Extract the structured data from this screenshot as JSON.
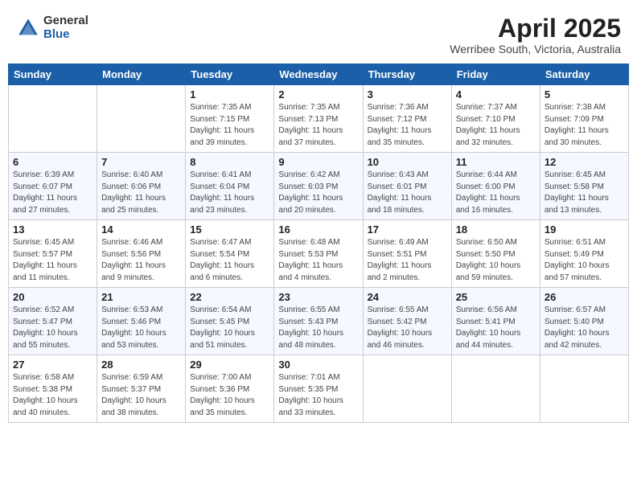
{
  "header": {
    "logo_general": "General",
    "logo_blue": "Blue",
    "month_title": "April 2025",
    "subtitle": "Werribee South, Victoria, Australia"
  },
  "days_of_week": [
    "Sunday",
    "Monday",
    "Tuesday",
    "Wednesday",
    "Thursday",
    "Friday",
    "Saturday"
  ],
  "weeks": [
    [
      {
        "day": "",
        "detail": ""
      },
      {
        "day": "",
        "detail": ""
      },
      {
        "day": "1",
        "detail": "Sunrise: 7:35 AM\nSunset: 7:15 PM\nDaylight: 11 hours and 39 minutes."
      },
      {
        "day": "2",
        "detail": "Sunrise: 7:35 AM\nSunset: 7:13 PM\nDaylight: 11 hours and 37 minutes."
      },
      {
        "day": "3",
        "detail": "Sunrise: 7:36 AM\nSunset: 7:12 PM\nDaylight: 11 hours and 35 minutes."
      },
      {
        "day": "4",
        "detail": "Sunrise: 7:37 AM\nSunset: 7:10 PM\nDaylight: 11 hours and 32 minutes."
      },
      {
        "day": "5",
        "detail": "Sunrise: 7:38 AM\nSunset: 7:09 PM\nDaylight: 11 hours and 30 minutes."
      }
    ],
    [
      {
        "day": "6",
        "detail": "Sunrise: 6:39 AM\nSunset: 6:07 PM\nDaylight: 11 hours and 27 minutes."
      },
      {
        "day": "7",
        "detail": "Sunrise: 6:40 AM\nSunset: 6:06 PM\nDaylight: 11 hours and 25 minutes."
      },
      {
        "day": "8",
        "detail": "Sunrise: 6:41 AM\nSunset: 6:04 PM\nDaylight: 11 hours and 23 minutes."
      },
      {
        "day": "9",
        "detail": "Sunrise: 6:42 AM\nSunset: 6:03 PM\nDaylight: 11 hours and 20 minutes."
      },
      {
        "day": "10",
        "detail": "Sunrise: 6:43 AM\nSunset: 6:01 PM\nDaylight: 11 hours and 18 minutes."
      },
      {
        "day": "11",
        "detail": "Sunrise: 6:44 AM\nSunset: 6:00 PM\nDaylight: 11 hours and 16 minutes."
      },
      {
        "day": "12",
        "detail": "Sunrise: 6:45 AM\nSunset: 5:58 PM\nDaylight: 11 hours and 13 minutes."
      }
    ],
    [
      {
        "day": "13",
        "detail": "Sunrise: 6:45 AM\nSunset: 5:57 PM\nDaylight: 11 hours and 11 minutes."
      },
      {
        "day": "14",
        "detail": "Sunrise: 6:46 AM\nSunset: 5:56 PM\nDaylight: 11 hours and 9 minutes."
      },
      {
        "day": "15",
        "detail": "Sunrise: 6:47 AM\nSunset: 5:54 PM\nDaylight: 11 hours and 6 minutes."
      },
      {
        "day": "16",
        "detail": "Sunrise: 6:48 AM\nSunset: 5:53 PM\nDaylight: 11 hours and 4 minutes."
      },
      {
        "day": "17",
        "detail": "Sunrise: 6:49 AM\nSunset: 5:51 PM\nDaylight: 11 hours and 2 minutes."
      },
      {
        "day": "18",
        "detail": "Sunrise: 6:50 AM\nSunset: 5:50 PM\nDaylight: 10 hours and 59 minutes."
      },
      {
        "day": "19",
        "detail": "Sunrise: 6:51 AM\nSunset: 5:49 PM\nDaylight: 10 hours and 57 minutes."
      }
    ],
    [
      {
        "day": "20",
        "detail": "Sunrise: 6:52 AM\nSunset: 5:47 PM\nDaylight: 10 hours and 55 minutes."
      },
      {
        "day": "21",
        "detail": "Sunrise: 6:53 AM\nSunset: 5:46 PM\nDaylight: 10 hours and 53 minutes."
      },
      {
        "day": "22",
        "detail": "Sunrise: 6:54 AM\nSunset: 5:45 PM\nDaylight: 10 hours and 51 minutes."
      },
      {
        "day": "23",
        "detail": "Sunrise: 6:55 AM\nSunset: 5:43 PM\nDaylight: 10 hours and 48 minutes."
      },
      {
        "day": "24",
        "detail": "Sunrise: 6:55 AM\nSunset: 5:42 PM\nDaylight: 10 hours and 46 minutes."
      },
      {
        "day": "25",
        "detail": "Sunrise: 6:56 AM\nSunset: 5:41 PM\nDaylight: 10 hours and 44 minutes."
      },
      {
        "day": "26",
        "detail": "Sunrise: 6:57 AM\nSunset: 5:40 PM\nDaylight: 10 hours and 42 minutes."
      }
    ],
    [
      {
        "day": "27",
        "detail": "Sunrise: 6:58 AM\nSunset: 5:38 PM\nDaylight: 10 hours and 40 minutes."
      },
      {
        "day": "28",
        "detail": "Sunrise: 6:59 AM\nSunset: 5:37 PM\nDaylight: 10 hours and 38 minutes."
      },
      {
        "day": "29",
        "detail": "Sunrise: 7:00 AM\nSunset: 5:36 PM\nDaylight: 10 hours and 35 minutes."
      },
      {
        "day": "30",
        "detail": "Sunrise: 7:01 AM\nSunset: 5:35 PM\nDaylight: 10 hours and 33 minutes."
      },
      {
        "day": "",
        "detail": ""
      },
      {
        "day": "",
        "detail": ""
      },
      {
        "day": "",
        "detail": ""
      }
    ]
  ]
}
